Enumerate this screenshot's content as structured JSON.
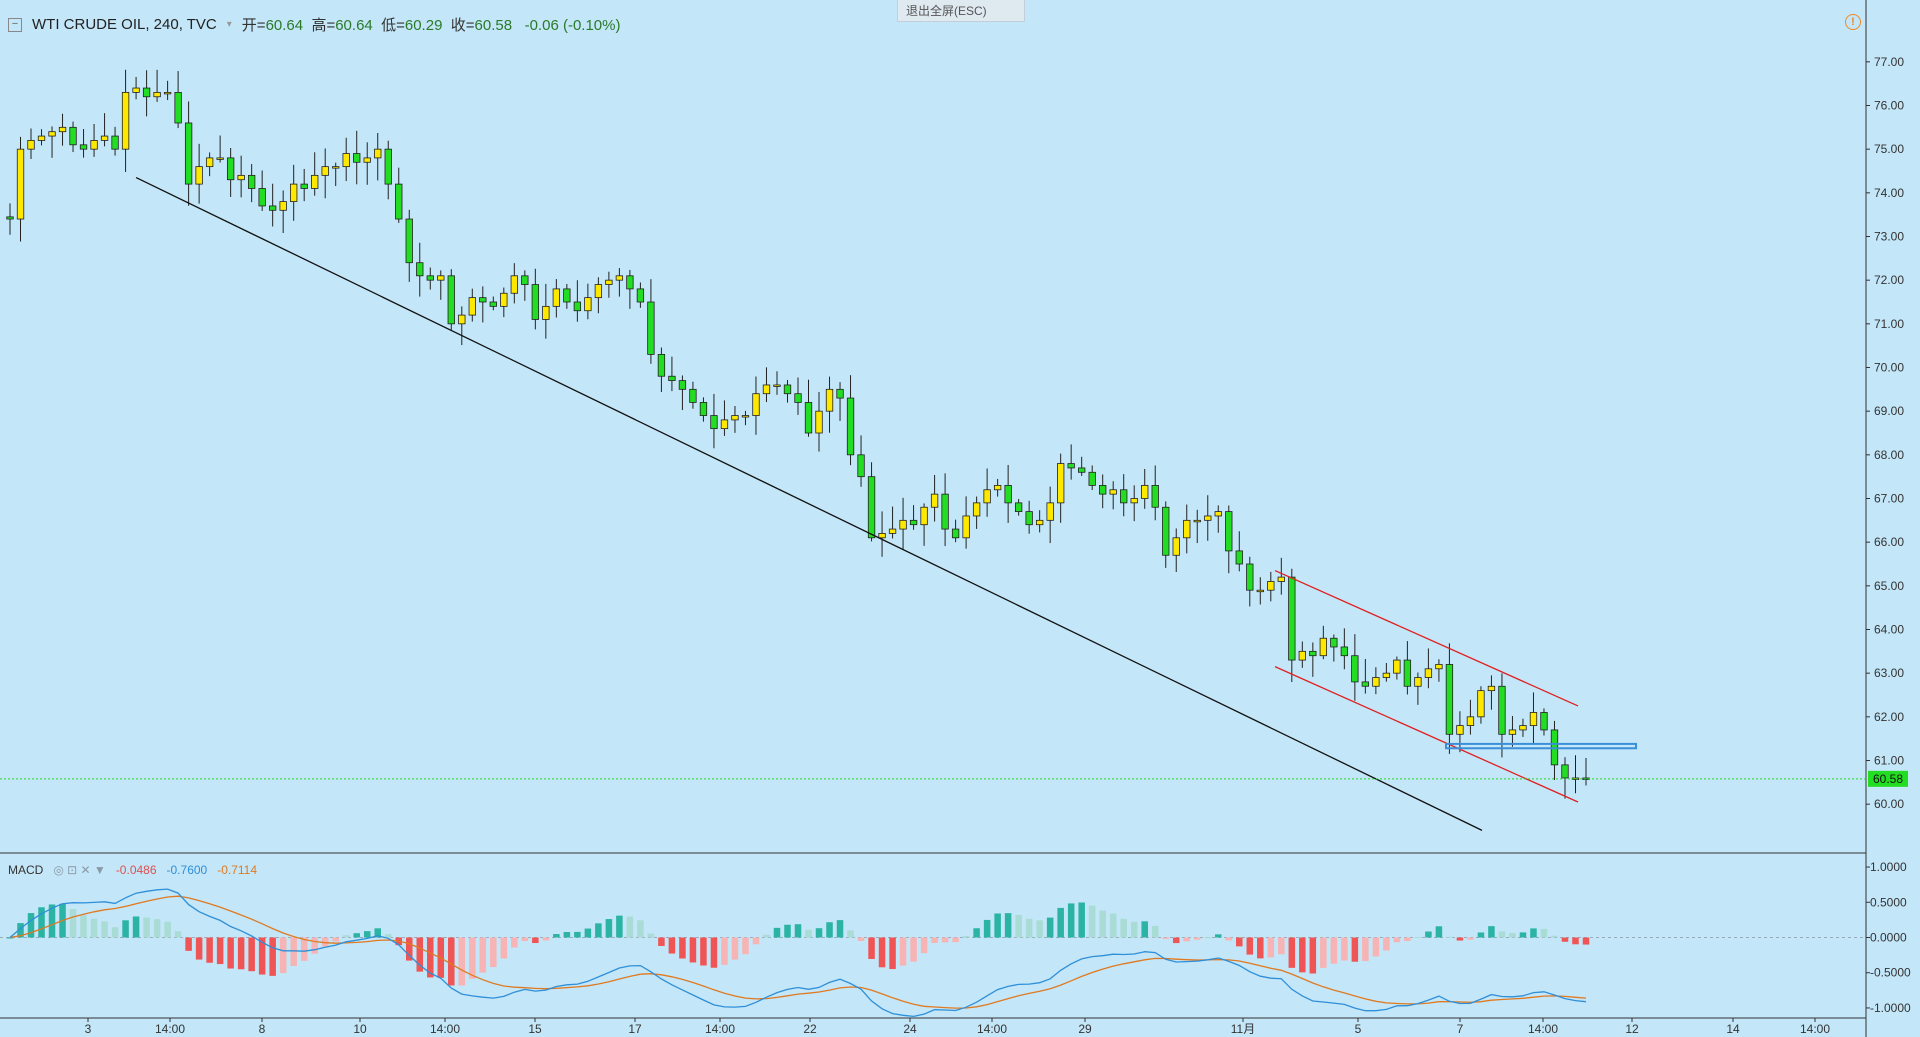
{
  "header": {
    "symbol": "WTI CRUDE OIL, 240, TVC",
    "open_label": "开=",
    "open_value": "60.64",
    "high_label": "高=",
    "high_value": "60.64",
    "low_label": "低=",
    "low_value": "60.29",
    "close_label": "收=",
    "close_value": "60.58",
    "change": "-0.06 (-0.10%)"
  },
  "exit_fullscreen": "退出全屏(ESC)",
  "macd": {
    "name": "MACD",
    "controls": "◎ ⊡ ✕ ▼",
    "hist": "-0.0486",
    "macd": "-0.7600",
    "signal": "-0.7114"
  },
  "colors": {
    "background": "#c3e6f8",
    "up": "#ffe800",
    "down": "#22dd22",
    "macd_line": "#2f8fd8",
    "signal_line": "#e07a20",
    "hist_pos": "#2bb3a4",
    "hist_neg": "#f05555",
    "channel": "#e02020",
    "trendline": "#111111",
    "level_box": "#3a8fd8",
    "last_price": "#22dd22"
  },
  "chart_data": [
    {
      "type": "candlestick",
      "title": "WTI CRUDE OIL, 240, TVC",
      "y_axis": {
        "ticks": [
          "77.00",
          "76.00",
          "75.00",
          "74.00",
          "73.00",
          "72.00",
          "71.00",
          "70.00",
          "69.00",
          "68.00",
          "67.00",
          "66.00",
          "65.00",
          "64.00",
          "63.00",
          "62.00",
          "61.00",
          "60.00"
        ],
        "range": [
          59.5,
          77.5
        ],
        "position": "right"
      },
      "x_axis": {
        "ticks": [
          "3",
          "14:00",
          "8",
          "10",
          "14:00",
          "15",
          "17",
          "14:00",
          "22",
          "24",
          "14:00",
          "29",
          "11月",
          "5",
          "7",
          "14:00",
          "12",
          "14",
          "14:00"
        ]
      },
      "last_price": "60.58",
      "closes": [
        73.4,
        75.0,
        75.2,
        75.3,
        75.4,
        75.5,
        75.1,
        75.0,
        75.2,
        75.3,
        75.0,
        76.3,
        76.4,
        76.2,
        76.3,
        76.3,
        75.6,
        74.2,
        74.6,
        74.8,
        74.8,
        74.3,
        74.4,
        74.1,
        73.7,
        73.6,
        73.8,
        74.2,
        74.1,
        74.4,
        74.6,
        74.6,
        74.9,
        74.7,
        74.8,
        75.0,
        74.2,
        73.4,
        72.4,
        72.1,
        72.0,
        72.1,
        71.0,
        71.2,
        71.6,
        71.5,
        71.4,
        71.7,
        72.1,
        71.9,
        71.1,
        71.4,
        71.8,
        71.5,
        71.3,
        71.6,
        71.9,
        72.0,
        72.1,
        71.8,
        71.5,
        70.3,
        69.8,
        69.7,
        69.5,
        69.2,
        68.9,
        68.6,
        68.8,
        68.9,
        68.9,
        69.4,
        69.6,
        69.6,
        69.4,
        69.2,
        68.5,
        69.0,
        69.5,
        69.3,
        68.0,
        67.5,
        66.1,
        66.2,
        66.3,
        66.5,
        66.4,
        66.8,
        67.1,
        66.3,
        66.1,
        66.6,
        66.9,
        67.2,
        67.3,
        66.9,
        66.7,
        66.4,
        66.5,
        66.9,
        67.8,
        67.7,
        67.6,
        67.3,
        67.1,
        67.2,
        66.9,
        67.0,
        67.3,
        66.8,
        65.7,
        66.1,
        66.5,
        66.5,
        66.6,
        66.7,
        65.8,
        65.5,
        64.9,
        64.9,
        65.1,
        65.2,
        63.3,
        63.5,
        63.4,
        63.8,
        63.6,
        63.4,
        62.8,
        62.7,
        62.9,
        63.0,
        63.3,
        62.7,
        62.9,
        63.1,
        63.2,
        61.6,
        61.8,
        62.0,
        62.6,
        62.7,
        61.6,
        61.7,
        61.8,
        62.1,
        61.7,
        60.9,
        60.6,
        60.6,
        60.58
      ]
    },
    {
      "type": "macd",
      "title": "MACD",
      "y_axis": {
        "ticks": [
          "1.0000",
          "0.5000",
          "0.0000",
          "-0.5000",
          "-1.0000"
        ],
        "range": [
          -1.1,
          1.1
        ],
        "position": "right"
      },
      "current": {
        "hist": "-0.0486",
        "macd": "-0.7600",
        "signal": "-0.7114"
      }
    }
  ]
}
